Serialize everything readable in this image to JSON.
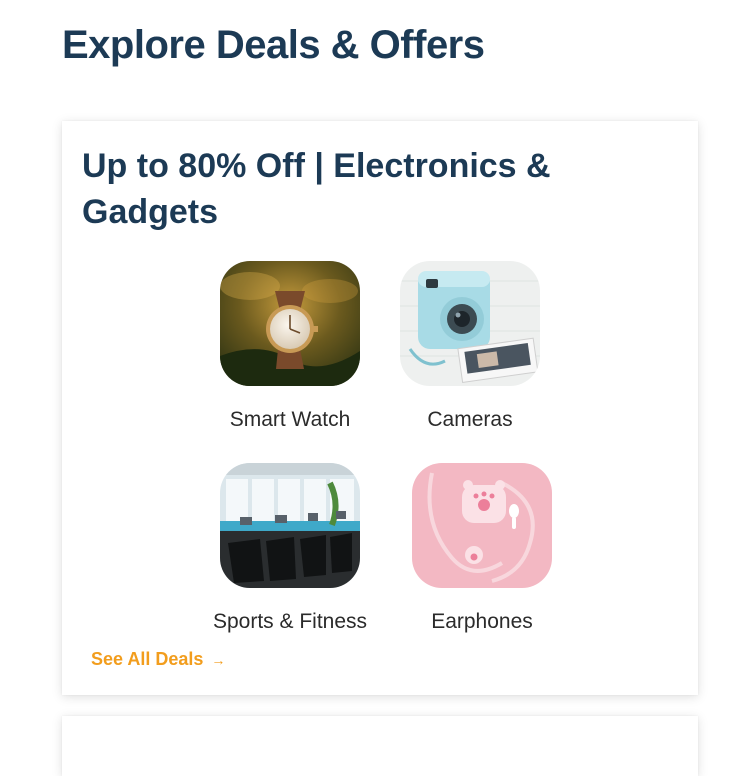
{
  "page": {
    "title": "Explore Deals & Offers"
  },
  "deal_card": {
    "title": "Up to 80% Off | Electronics & Gadgets",
    "items": [
      {
        "label": "Smart Watch",
        "icon": "watch-image"
      },
      {
        "label": "Cameras",
        "icon": "instant-camera-image"
      },
      {
        "label": "Sports & Fitness",
        "icon": "treadmill-gym-image"
      },
      {
        "label": "Earphones",
        "icon": "earphones-case-image"
      }
    ],
    "see_all": "See All Deals",
    "see_all_arrow": "→"
  },
  "colors": {
    "heading": "#1c3a55",
    "link": "#f29d1d",
    "label": "#2b2b2b"
  }
}
